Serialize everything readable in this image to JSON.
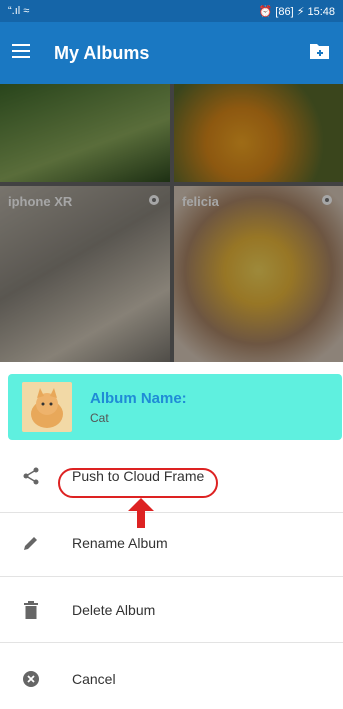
{
  "status_bar": {
    "signal": "“.ıl ≈",
    "right": "⏰ [86] ⚡ 15:48"
  },
  "app_bar": {
    "title": "My Albums"
  },
  "albums": [
    {
      "name": ""
    },
    {
      "name": ""
    },
    {
      "name": "iphone XR"
    },
    {
      "name": "felicia"
    }
  ],
  "sheet": {
    "album_name_label": "Album Name:",
    "album_name_value": "Cat",
    "items": [
      {
        "label": "Push to Cloud Frame",
        "icon": "share-icon"
      },
      {
        "label": "Rename Album",
        "icon": "pencil-icon"
      },
      {
        "label": "Delete Album",
        "icon": "trash-icon"
      },
      {
        "label": "Cancel",
        "icon": "cancel-icon"
      }
    ]
  },
  "colors": {
    "appbar": "#1a78c2",
    "header": "#5ff0df",
    "accent": "#1f8bd6",
    "highlight": "#dd2222"
  }
}
